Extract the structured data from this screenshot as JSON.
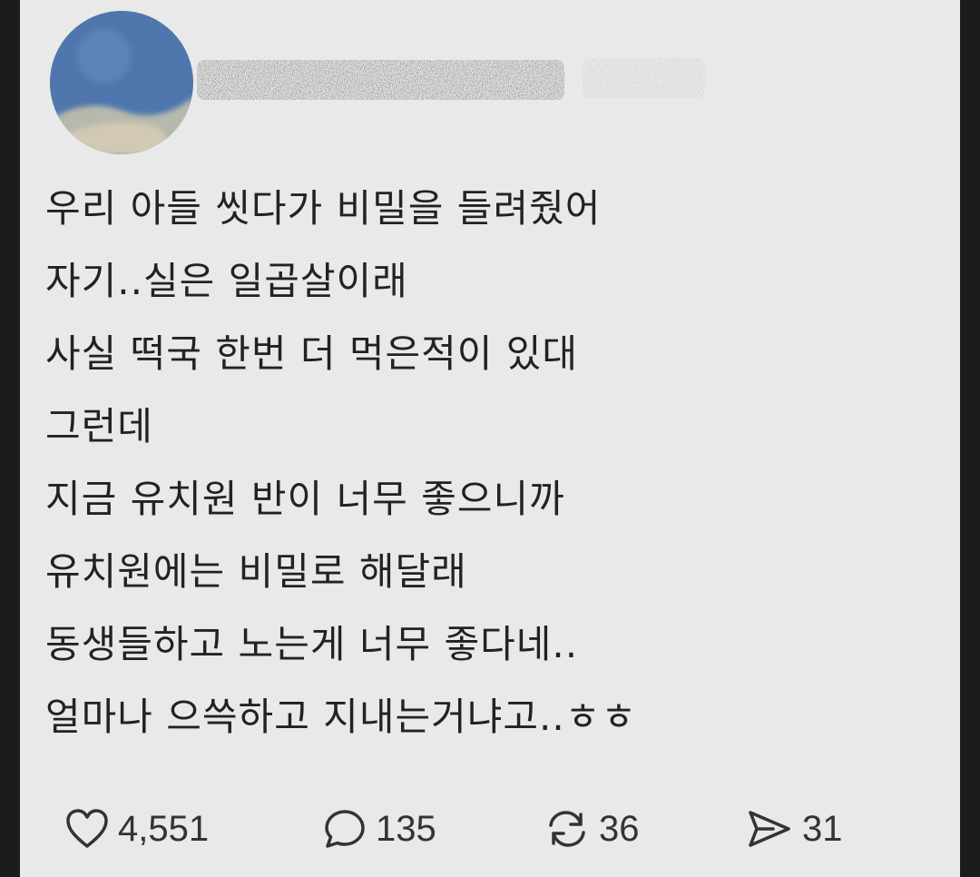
{
  "post": {
    "author": {
      "avatar_icon": "avatar-blurred-icon"
    },
    "lines": [
      "우리 아들 씻다가 비밀을 들려줬어",
      "자기..실은 일곱살이래",
      "사실 떡국 한번 더 먹은적이 있대",
      "그런데",
      "지금 유치원 반이 너무 좋으니까",
      "유치원에는 비밀로 해달래",
      "동생들하고 노는게 너무 좋다네..",
      "얼마나 으쓱하고 지내는거냐고..ㅎㅎ"
    ],
    "actions": {
      "likes": "4,551",
      "replies": "135",
      "reposts": "36",
      "shares": "31"
    }
  },
  "colors": {
    "background": "#e9e9e9",
    "frame": "#1c1c1c",
    "text": "#222222",
    "icon": "#333333"
  }
}
